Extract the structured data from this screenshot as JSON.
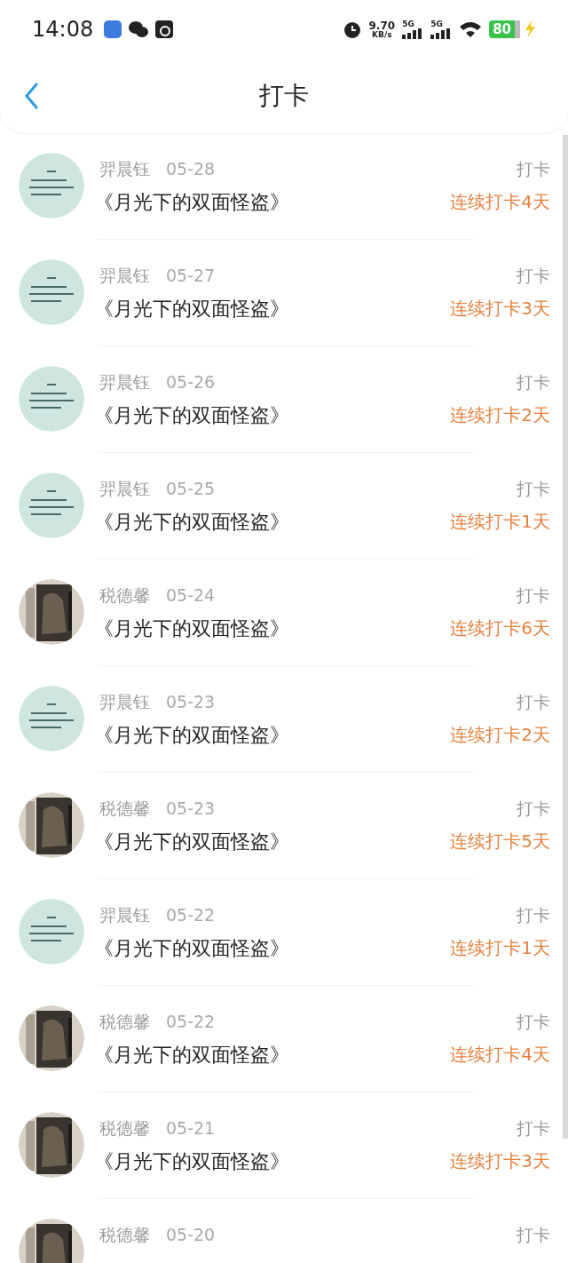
{
  "status_bar": {
    "time": "14:08",
    "speed_value": "9.70",
    "speed_unit": "KB/s",
    "signal_1": "5G",
    "signal_2": "5G",
    "battery": "80"
  },
  "nav": {
    "title": "打卡"
  },
  "entries": [
    {
      "kind": "teal",
      "name": "羿晨钰",
      "date": "05-28",
      "label": "打卡",
      "title": "《月光下的双面怪盗》",
      "streak": "连续打卡4天"
    },
    {
      "kind": "teal",
      "name": "羿晨钰",
      "date": "05-27",
      "label": "打卡",
      "title": "《月光下的双面怪盗》",
      "streak": "连续打卡3天"
    },
    {
      "kind": "teal",
      "name": "羿晨钰",
      "date": "05-26",
      "label": "打卡",
      "title": "《月光下的双面怪盗》",
      "streak": "连续打卡2天"
    },
    {
      "kind": "teal",
      "name": "羿晨钰",
      "date": "05-25",
      "label": "打卡",
      "title": "《月光下的双面怪盗》",
      "streak": "连续打卡1天"
    },
    {
      "kind": "dark",
      "name": "税德馨",
      "date": "05-24",
      "label": "打卡",
      "title": "《月光下的双面怪盗》",
      "streak": "连续打卡6天"
    },
    {
      "kind": "teal",
      "name": "羿晨钰",
      "date": "05-23",
      "label": "打卡",
      "title": "《月光下的双面怪盗》",
      "streak": "连续打卡2天"
    },
    {
      "kind": "dark",
      "name": "税德馨",
      "date": "05-23",
      "label": "打卡",
      "title": "《月光下的双面怪盗》",
      "streak": "连续打卡5天"
    },
    {
      "kind": "teal",
      "name": "羿晨钰",
      "date": "05-22",
      "label": "打卡",
      "title": "《月光下的双面怪盗》",
      "streak": "连续打卡1天"
    },
    {
      "kind": "dark",
      "name": "税德馨",
      "date": "05-22",
      "label": "打卡",
      "title": "《月光下的双面怪盗》",
      "streak": "连续打卡4天"
    },
    {
      "kind": "dark",
      "name": "税德馨",
      "date": "05-21",
      "label": "打卡",
      "title": "《月光下的双面怪盗》",
      "streak": "连续打卡3天"
    },
    {
      "kind": "dark",
      "name": "税德馨",
      "date": "05-20",
      "label": "打卡"
    }
  ]
}
